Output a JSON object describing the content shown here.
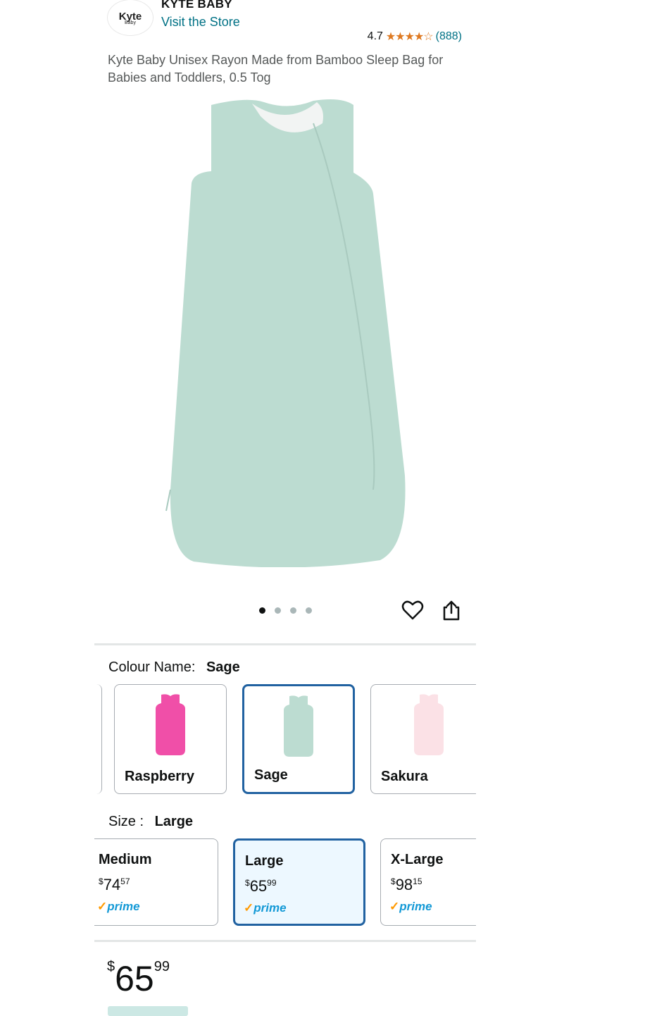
{
  "header": {
    "logo_text": "Kyte",
    "logo_sub": "Baby",
    "brand": "KYTE BABY",
    "store_link": "Visit the Store",
    "rating": "4.7",
    "stars": "★★★★☆",
    "review_count": "(888)"
  },
  "product": {
    "title": "Kyte Baby Unisex Rayon Made from Bamboo Sleep Bag for Babies and Toddlers, 0.5 Tog",
    "image_icon": "sleep-bag-image",
    "color_hex": "#bcdcd1"
  },
  "carousel": {
    "dots": 4,
    "active": 0
  },
  "colour": {
    "label": "Colour Name:",
    "selected": "Sage",
    "options": [
      {
        "name": "Raspberry",
        "color": "#f04fa8"
      },
      {
        "name": "Sage",
        "color": "#bcdcd1"
      },
      {
        "name": "Sakura",
        "color": "#fbe1e6"
      }
    ]
  },
  "size": {
    "label": "Size :",
    "selected": "Large",
    "options": [
      {
        "name": "Medium",
        "cur": "$",
        "whole": "74",
        "frac": "57",
        "prime": "prime"
      },
      {
        "name": "Large",
        "cur": "$",
        "whole": "65",
        "frac": "99",
        "prime": "prime"
      },
      {
        "name": "X-Large",
        "cur": "$",
        "whole": "98",
        "frac": "15",
        "prime": "prime"
      }
    ]
  },
  "price": {
    "cur": "$",
    "whole": "65",
    "frac": "99"
  }
}
